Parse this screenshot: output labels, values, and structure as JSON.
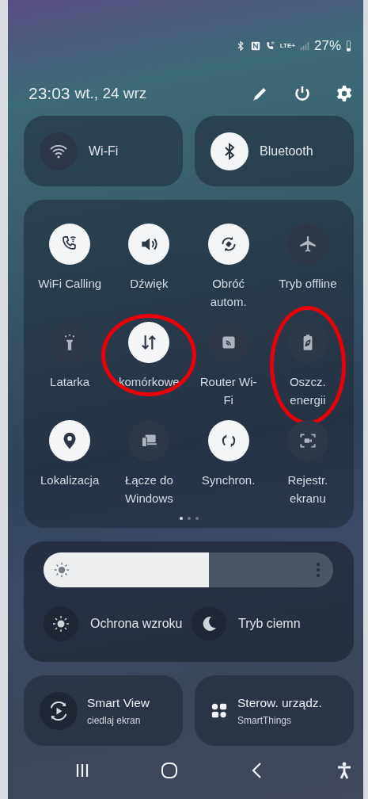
{
  "status_bar": {
    "network": "LTE+",
    "battery": "27%"
  },
  "header": {
    "time": "23:03",
    "date": "wt., 24 wrz"
  },
  "top_toggles": [
    {
      "label": "Wi-Fi",
      "on": false
    },
    {
      "label": "Bluetooth",
      "on": true
    }
  ],
  "tiles": [
    {
      "label": "WiFi Calling",
      "on": true,
      "circled": false
    },
    {
      "label": "Dźwięk",
      "on": true,
      "circled": false
    },
    {
      "label": "Obróć autom.",
      "on": true,
      "circled": false
    },
    {
      "label": "Tryb offline",
      "on": false,
      "circled": false
    },
    {
      "label": "Latarka",
      "on": false,
      "circled": false
    },
    {
      "label": "komórkowe",
      "on": true,
      "circled": true
    },
    {
      "label": "Router Wi-Fi",
      "on": false,
      "circled": false
    },
    {
      "label": "Oszcz. energii",
      "on": false,
      "circled": true
    },
    {
      "label": "Lokalizacja",
      "on": true,
      "circled": false
    },
    {
      "label": "Łącze do Windows",
      "on": false,
      "circled": false
    },
    {
      "label": "Synchron.",
      "on": true,
      "circled": false
    },
    {
      "label": "Rejestr. ekranu",
      "on": false,
      "circled": false
    }
  ],
  "pages": [
    {
      "selected": true
    },
    {
      "selected": false
    },
    {
      "selected": false
    }
  ],
  "brightness": {
    "level": 0.57
  },
  "display_toggles": [
    {
      "label": "Ochrona wzroku",
      "on": false
    },
    {
      "label": "Tryb ciemn",
      "on": false
    }
  ],
  "shortcuts": [
    {
      "title": "Smart View",
      "subtitle": "ciedlaj ekran"
    },
    {
      "title": "Sterow. urządz.",
      "subtitle": "SmartThings"
    }
  ]
}
